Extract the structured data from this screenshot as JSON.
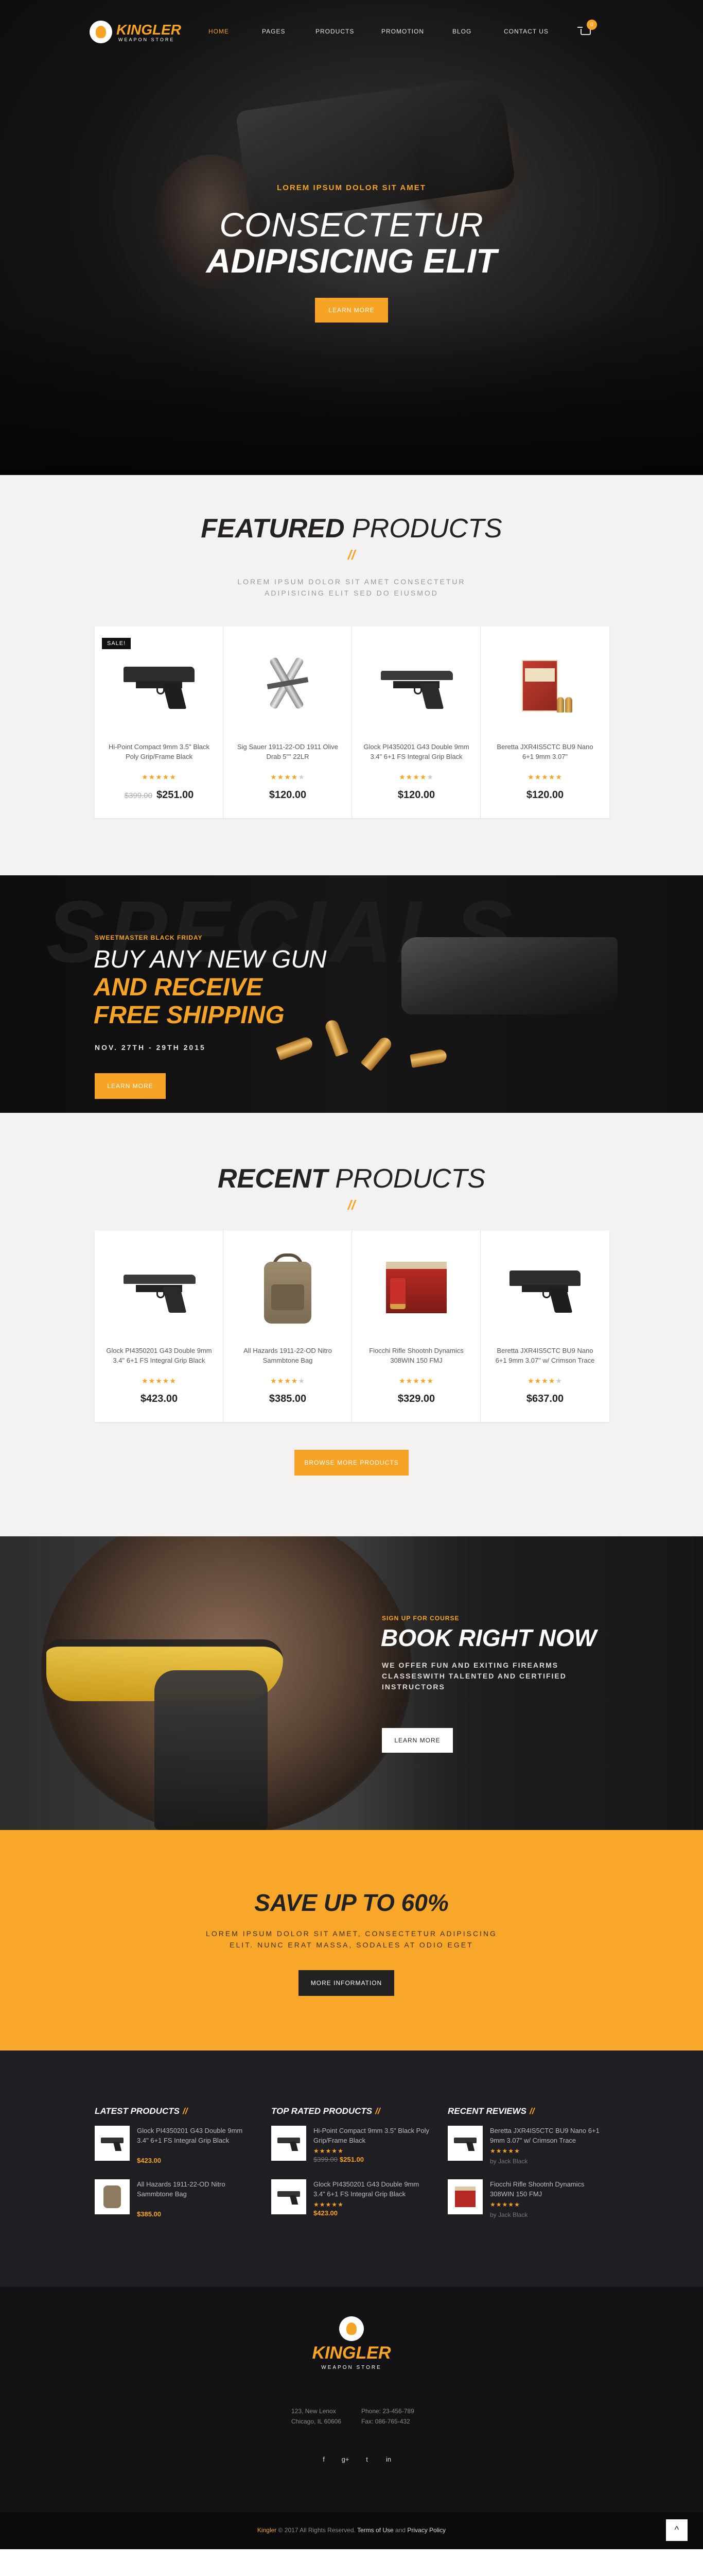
{
  "brand": {
    "name": "KINGLER",
    "sub": "WEAPON STORE"
  },
  "nav": {
    "items": [
      "HOME",
      "PAGES",
      "PRODUCTS",
      "PROMOTION",
      "BLOG",
      "CONTACT US"
    ],
    "active": "HOME",
    "cart_count": "0"
  },
  "hero": {
    "kicker": "LOREM IPSUM DOLOR SIT AMET",
    "title_line1": "CONSECTETUR",
    "title_line2": "ADIPISICING ELIT",
    "button": "LEARN MORE"
  },
  "featured": {
    "title_bold": "FEATURED",
    "title_light": "PRODUCTS",
    "mark": "//",
    "subtitle": "LOREM IPSUM DOLOR SIT AMET CONSECTETUR ADIPISICING ELIT SED DO EIUSMOD",
    "products": [
      {
        "badge": "SALE!",
        "name": "Hi-Point Compact 9mm 3.5\" Black Poly Grip/Frame Black",
        "stars": 5,
        "old_price": "$399.00",
        "price": "$251.00",
        "image": "pistol"
      },
      {
        "badge": "",
        "name": "Sig Sauer 1911-22-OD 1911 Olive Drab 5\"\" 22LR",
        "stars": 4,
        "old_price": "",
        "price": "$120.00",
        "image": "multitool"
      },
      {
        "badge": "",
        "name": "Glock PI4350201 G43 Double 9mm 3.4\" 6+1 FS Integral Grip Black",
        "stars": 4,
        "old_price": "",
        "price": "$120.00",
        "image": "target-pistol"
      },
      {
        "badge": "",
        "name": "Beretta JXR4IS5CTC BU9 Nano 6+1 9mm 3.07\"",
        "stars": 5,
        "old_price": "",
        "price": "$120.00",
        "image": "ammo-box"
      }
    ]
  },
  "specials": {
    "bg_text": "SPECIALS",
    "kicker": "SWEETMASTER BLACK FRIDAY",
    "line1": "BUY ANY NEW GUN",
    "line2": "AND RECEIVE",
    "line3": "FREE SHIPPING",
    "date": "NOV. 27TH - 29TH 2015",
    "button": "LEARN MORE"
  },
  "recent": {
    "title_bold": "RECENT",
    "title_light": "PRODUCTS",
    "mark": "//",
    "button": "BROWSE MORE PRODUCTS",
    "products": [
      {
        "name": "Glock PI4350201 G43 Double 9mm 3.4\" 6+1 FS Integral Grip Black",
        "stars": 5,
        "price": "$423.00",
        "image": "target-pistol"
      },
      {
        "name": "All Hazards 1911-22-OD Nitro Sammbtone Bag",
        "stars": 4,
        "price": "$385.00",
        "image": "bag"
      },
      {
        "name": "Fiocchi Rifle Shootnh Dynamics 308WIN 150 FMJ",
        "stars": 5,
        "price": "$329.00",
        "image": "estate-box"
      },
      {
        "name": "Beretta JXR4IS5CTC BU9 Nano 6+1 9mm 3.07\" w/ Crimson Trace",
        "stars": 4,
        "price": "$637.00",
        "image": "compact-pistol"
      }
    ]
  },
  "book": {
    "kicker": "SIGN UP FOR COURSE",
    "title": "BOOK RIGHT NOW",
    "text": "WE OFFER FUN AND EXITING FIREARMS CLASSESWITH TALENTED AND CERTIFIED INSTRUCTORS",
    "button": "LEARN MORE"
  },
  "save": {
    "title": "SAVE UP TO 60%",
    "text": "LOREM IPSUM DOLOR SIT AMET, CONSECTETUR ADIPISCING ELIT. NUNC ERAT MASSA, SODALES AT ODIO EGET",
    "button": "MORE INFORMATION"
  },
  "widgets": {
    "latest": {
      "title": "LATEST PRODUCTS",
      "items": [
        {
          "name": "Glock PI4350201 G43 Double 9mm 3.4\" 6+1 FS Integral Grip Black",
          "price": "$423.00"
        },
        {
          "name": "All Hazards 1911-22-OD Nitro Sammbtone Bag",
          "price": "$385.00"
        }
      ]
    },
    "top_rated": {
      "title": "TOP RATED PRODUCTS",
      "items": [
        {
          "name": "Hi-Point Compact 9mm 3.5\" Black Poly Grip/Frame Black",
          "stars": 5,
          "old_price": "$399.00",
          "price": "$251.00"
        },
        {
          "name": "Glock PI4350201 G43 Double 9mm 3.4\" 6+1 FS Integral Grip Black",
          "stars": 5,
          "old_price": "",
          "price": "$423.00"
        }
      ]
    },
    "reviews": {
      "title": "RECENT REVIEWS",
      "items": [
        {
          "name": "Beretta JXR4IS5CTC BU9 Nano 6+1 9mm 3.07\" w/ Crimson Trace",
          "stars": 4,
          "by": "by Jack Black"
        },
        {
          "name": "Fiocchi Rifle Shootnh Dynamics 308WIN 150 FMJ",
          "stars": 5,
          "by": "by Jack Black"
        }
      ]
    },
    "slash": "//"
  },
  "footer": {
    "address": [
      "123, New Lenox",
      "Chicago, IL 60606"
    ],
    "contact": [
      "Phone: 23-456-789",
      "Fax: 086-765-432"
    ],
    "social": [
      "f",
      "g+",
      "t",
      "in"
    ],
    "copy_brand": "Kingler",
    "copy_text": " © 2017 All Rights Reserved. ",
    "copy_terms": "Terms of Use",
    "copy_and": " and ",
    "copy_privacy": "Privacy Policy",
    "to_top": "^"
  },
  "colors": {
    "accent": "#f7a325",
    "dark": "#1f1f23",
    "light_bg": "#f3f2f1"
  }
}
